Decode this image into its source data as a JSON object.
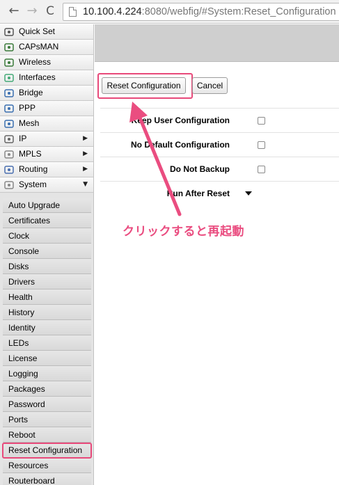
{
  "browser": {
    "back_icon": "back-arrow-icon",
    "forward_icon": "forward-arrow-icon",
    "reload_icon": "reload-icon",
    "url_host": "10.100.4.224",
    "url_rest": ":8080/webfig/#System:Reset_Configuration"
  },
  "sidebar": {
    "items": [
      {
        "label": "Quick Set",
        "icon": "quick-set-icon",
        "arrow": ""
      },
      {
        "label": "CAPsMAN",
        "icon": "capsman-icon",
        "arrow": ""
      },
      {
        "label": "Wireless",
        "icon": "wireless-icon",
        "arrow": ""
      },
      {
        "label": "Interfaces",
        "icon": "interfaces-icon",
        "arrow": ""
      },
      {
        "label": "Bridge",
        "icon": "bridge-icon",
        "arrow": ""
      },
      {
        "label": "PPP",
        "icon": "ppp-icon",
        "arrow": ""
      },
      {
        "label": "Mesh",
        "icon": "mesh-icon",
        "arrow": ""
      },
      {
        "label": "IP",
        "icon": "ip-icon",
        "arrow": "▶"
      },
      {
        "label": "MPLS",
        "icon": "mpls-icon",
        "arrow": "▶"
      },
      {
        "label": "Routing",
        "icon": "routing-icon",
        "arrow": "▶"
      },
      {
        "label": "System",
        "icon": "system-icon",
        "arrow": "▼"
      }
    ],
    "system_submenu": [
      "Auto Upgrade",
      "Certificates",
      "Clock",
      "Console",
      "Disks",
      "Drivers",
      "Health",
      "History",
      "Identity",
      "LEDs",
      "License",
      "Logging",
      "Packages",
      "Password",
      "Ports",
      "Reboot",
      "Reset Configuration",
      "Resources",
      "Routerboard"
    ],
    "active_submenu": "Reset Configuration"
  },
  "main": {
    "reset_button": "Reset Configuration",
    "cancel_button": "Cancel",
    "options": [
      {
        "label": "Keep User Configuration",
        "type": "checkbox",
        "checked": false
      },
      {
        "label": "No Default Configuration",
        "type": "checkbox",
        "checked": false
      },
      {
        "label": "Do Not Backup",
        "type": "checkbox",
        "checked": false
      },
      {
        "label": "Run After Reset",
        "type": "dropdown",
        "value": ""
      }
    ]
  },
  "annotation": {
    "text": "クリックすると再起動",
    "color": "#ea4d80"
  }
}
